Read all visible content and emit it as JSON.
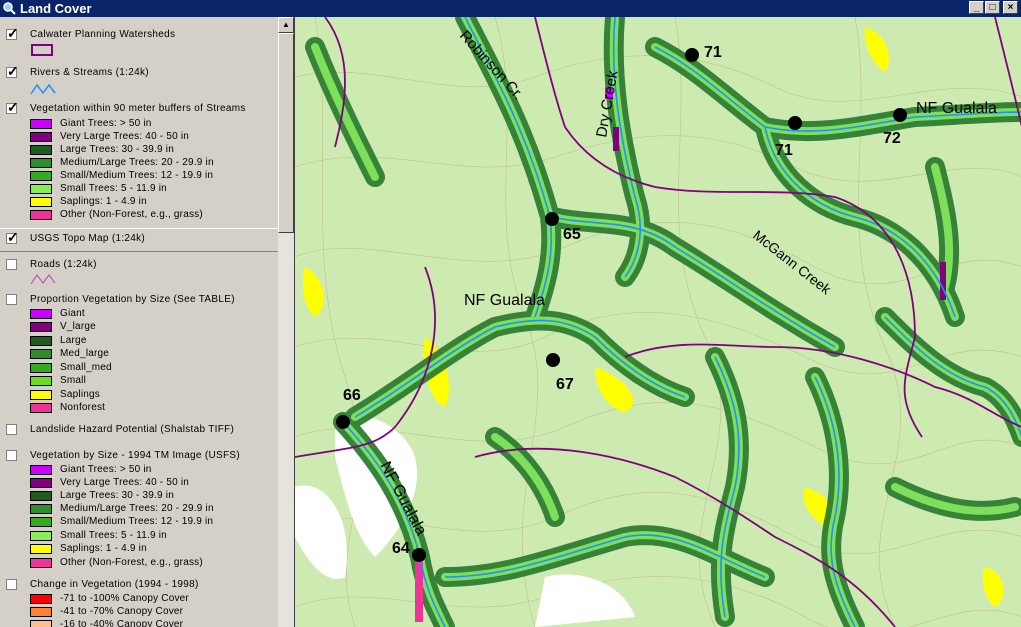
{
  "window": {
    "title": "Land Cover"
  },
  "toc": {
    "layers": [
      {
        "label": "Calwater Planning Watersheds",
        "checked": true
      },
      {
        "label": "Rivers & Streams (1:24k)",
        "checked": true
      },
      {
        "label": "Vegetation within 90 meter buffers of Streams",
        "checked": true,
        "legend": [
          {
            "label": "Giant Trees: > 50 in",
            "color": "#cc00ff"
          },
          {
            "label": "Very Large Trees: 40 - 50 in",
            "color": "#800080"
          },
          {
            "label": "Large Trees: 30 - 39.9 in",
            "color": "#1f5a1f"
          },
          {
            "label": "Medium/Large Trees: 20 - 29.9 in",
            "color": "#2e8b2e"
          },
          {
            "label": "Small/Medium Trees: 12 - 19.9 in",
            "color": "#33aa22"
          },
          {
            "label": "Small Trees: 5 - 11.9 in",
            "color": "#88ee55"
          },
          {
            "label": "Saplings: 1 - 4.9 in",
            "color": "#ffff00"
          },
          {
            "label": "Other (Non-Forest, e.g., grass)",
            "color": "#ee3399"
          }
        ]
      },
      {
        "label": "USGS Topo  Map (1:24k)",
        "checked": true
      },
      {
        "label": "Roads (1:24k)",
        "checked": false
      },
      {
        "label": "Proportion Vegetation by Size (See TABLE)",
        "checked": false,
        "legend": [
          {
            "label": "Giant",
            "color": "#cc00ff"
          },
          {
            "label": "V_large",
            "color": "#800080"
          },
          {
            "label": "Large",
            "color": "#1f5a1f"
          },
          {
            "label": "Med_large",
            "color": "#2e8b2e"
          },
          {
            "label": "Small_med",
            "color": "#33aa22"
          },
          {
            "label": "Small",
            "color": "#66dd22"
          },
          {
            "label": "Saplings",
            "color": "#ffff00"
          },
          {
            "label": "Nonforest",
            "color": "#ee3399"
          }
        ]
      },
      {
        "label": "Landslide Hazard Potential (Shalstab TIFF)",
        "checked": false
      },
      {
        "label": "Vegetation by Size - 1994 TM Image (USFS)",
        "checked": false,
        "legend": [
          {
            "label": "Giant Trees: > 50 in",
            "color": "#cc00ff"
          },
          {
            "label": "Very Large Trees: 40 - 50 in",
            "color": "#800080"
          },
          {
            "label": "Large Trees: 30 - 39.9 in",
            "color": "#1f5a1f"
          },
          {
            "label": "Medium/Large Trees: 20 - 29.9 in",
            "color": "#2e8b2e"
          },
          {
            "label": "Small/Medium Trees: 12 - 19.9 in",
            "color": "#33aa22"
          },
          {
            "label": "Small Trees: 5 - 11.9 in",
            "color": "#88ee55"
          },
          {
            "label": "Saplings: 1 - 4.9 in",
            "color": "#ffff00"
          },
          {
            "label": "Other (Non-Forest, e.g., grass)",
            "color": "#ee3399"
          }
        ]
      },
      {
        "label": "Change in Vegetation (1994 - 1998)",
        "checked": false,
        "legend": [
          {
            "label": "-71 to -100% Canopy Cover",
            "color": "#ff0000"
          },
          {
            "label": "-41 to -70% Canopy Cover",
            "color": "#ff8030"
          },
          {
            "label": "-16 to -40% Canopy Cover",
            "color": "#ffc090"
          }
        ]
      }
    ]
  },
  "map": {
    "streams": [
      {
        "label": "Robinson Cr."
      },
      {
        "label": "Dry Creek"
      },
      {
        "label": "McGann Creek"
      },
      {
        "label": "NF Gualala"
      },
      {
        "label": "NF Gualala"
      },
      {
        "label": "NF Gualala"
      }
    ],
    "sites": [
      "71",
      "71",
      "72",
      "65",
      "67",
      "66",
      "64"
    ],
    "colors": {
      "stream": "#1e90ff",
      "road": "#800080",
      "buffer_dark": "#2e7d32",
      "buffer_light": "#7ee05a",
      "sapling": "#ffff00",
      "topo_bg": "#cdebb0"
    }
  }
}
